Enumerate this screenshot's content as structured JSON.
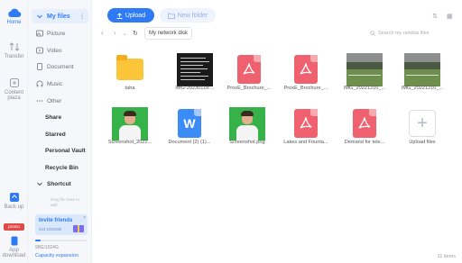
{
  "rail": {
    "home": "Home",
    "transfer": "Transfer",
    "content_plaza": "Content plaza",
    "backup": "Back up",
    "app_download": "App download",
    "promo_badge": "promo"
  },
  "sidebar": {
    "my_files": "My files",
    "items": [
      {
        "label": "Picture"
      },
      {
        "label": "Video"
      },
      {
        "label": "Document"
      },
      {
        "label": "Music"
      },
      {
        "label": "Other"
      }
    ],
    "groups": [
      {
        "label": "Share"
      },
      {
        "label": "Starred"
      },
      {
        "label": "Personal Vault"
      },
      {
        "label": "Recycle Bin"
      }
    ],
    "shortcut": "Shortcut",
    "shortcut_hint": "Drag file here to add",
    "invite_title": "Invite friends",
    "invite_sub": "Get 1024GB",
    "storage_text": "99G/1024G",
    "storage_fraction": 0.097,
    "capacity": "Capacity expansion"
  },
  "toolbar": {
    "upload": "Upload",
    "new_folder": "New folder"
  },
  "nav": {
    "breadcrumb": "My network disk",
    "search_placeholder": "Search my netdisk files"
  },
  "files": [
    {
      "name": "taha",
      "type": "folder"
    },
    {
      "name": "IMG-20230118-...",
      "type": "image-dark"
    },
    {
      "name": "ProxE_Brochure_...",
      "type": "pdf"
    },
    {
      "name": "ProxE_Brochure_...",
      "type": "pdf"
    },
    {
      "name": "IMG_20221210_...",
      "type": "image-field"
    },
    {
      "name": "IMG_20221210_...",
      "type": "image-field"
    },
    {
      "name": "Screenshot_2022...",
      "type": "image-person"
    },
    {
      "name": "Document (2) (1)...",
      "type": "doc"
    },
    {
      "name": "Screenshot.png",
      "type": "image-person"
    },
    {
      "name": "Lakes and Founta...",
      "type": "pdf"
    },
    {
      "name": "Demand for tele...",
      "type": "pdf"
    },
    {
      "name": "Upload files",
      "type": "upload"
    }
  ],
  "item_count": "11 items",
  "colors": {
    "accent": "#2f7bf5",
    "pdf": "#f0616f",
    "doc": "#3b8cf7",
    "folder": "#fbc53a"
  }
}
